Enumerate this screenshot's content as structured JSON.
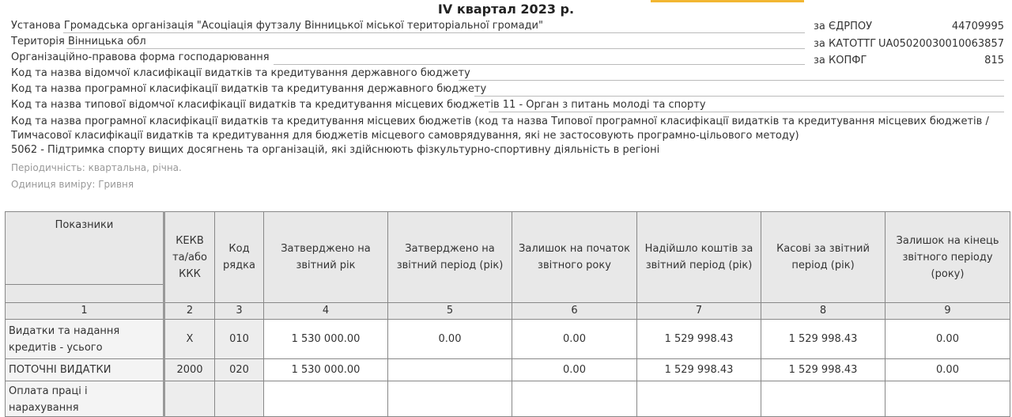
{
  "period_title": "IV квартал 2023 р.",
  "header": {
    "institution_label": "Установа",
    "institution_value": "Громадська організація \"Асоціація футзалу Вінницької міської територіальної громади\"",
    "territory_label": "Територія",
    "territory_value": "Вінницька обл",
    "legal_form_label": "Організаційно-правова форма господарювання",
    "dept_class_label": "Код та назва відомчої класифікації видатків та кредитування державного бюджету",
    "program_class_label": "Код та назва програмної класифікації видатків та кредитування державного бюджету",
    "typical_dept_label": "Код та назва типової відомчої класифікації видатків та кредитування місцевих бюджетів",
    "typical_dept_value": "11 - Орган з питань молоді та спорту",
    "local_program_line1": "Код та назва програмної класифікації видатків та кредитування місцевих бюджетів (код та назва Типової програмної класифікації видатків та кредитування місцевих бюджетів /",
    "local_program_line2": "Тимчасової класифікації видатків та кредитування для бюджетів місцевого самоврядування, які не застосовують програмно-цільового методу)",
    "local_program_value": "5062 - Підтримка спорту вищих досягнень та організацій, які здійснюють фізкультурно-спортивну діяльність в регіоні",
    "periodicity": "Періодичність: квартальна, річна.",
    "unit": "Одиниця виміру: Гривня"
  },
  "codes": {
    "edrpou_label": "за ЄДРПОУ",
    "edrpou_value": "44709995",
    "katottg_label": "за КАТОТТГ",
    "katottg_value": "UA05020030010063857",
    "kopfg_label": "за КОПФГ",
    "kopfg_value": "815"
  },
  "table": {
    "headers": {
      "indicators": "Показники",
      "kekv": "КЕКВ та/або ККК",
      "row_code": "Код рядка",
      "approved_year": "Затверджено на звітний рік",
      "approved_period": "Затверджено на звітний період (рік)",
      "balance_start": "Залишок на початок звітного року",
      "received": "Надійшло коштів за звітний період (рік)",
      "cash": "Касові за звітний період (рік)",
      "balance_end": "Залишок на кінець звітного періоду (року)"
    },
    "col_numbers": [
      "1",
      "2",
      "3",
      "4",
      "5",
      "6",
      "7",
      "8",
      "9"
    ],
    "rows": [
      {
        "name": "Видатки та надання кредитів - усього",
        "kekv": "X",
        "code": "010",
        "c4": "1 530 000.00",
        "c5": "0.00",
        "c6": "0.00",
        "c7": "1 529 998.43",
        "c8": "1 529 998.43",
        "c9": "0.00"
      },
      {
        "name": "ПОТОЧНІ ВИДАТКИ",
        "kekv": "2000",
        "code": "020",
        "c4": "1 530 000.00",
        "c5": "",
        "c6": "0.00",
        "c7": "1 529 998.43",
        "c8": "1 529 998.43",
        "c9": "0.00"
      },
      {
        "name": "Оплата праці і нарахування",
        "kekv": "",
        "code": "",
        "c4": "",
        "c5": "",
        "c6": "",
        "c7": "",
        "c8": "",
        "c9": ""
      }
    ]
  }
}
